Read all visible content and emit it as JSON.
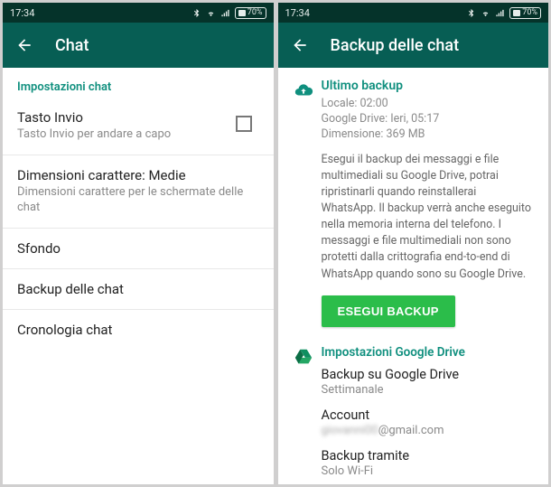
{
  "status": {
    "time": "17:34",
    "battery": "70%"
  },
  "left": {
    "title": "Chat",
    "section": "Impostazioni chat",
    "items": {
      "enter": {
        "title": "Tasto Invio",
        "sub": "Tasto Invio per andare a capo"
      },
      "font": {
        "title": "Dimensioni carattere: Medie",
        "sub": "Dimensioni carattere per le schermate delle chat"
      },
      "wallpaper": {
        "title": "Sfondo"
      },
      "backup": {
        "title": "Backup delle chat"
      },
      "history": {
        "title": "Cronologia chat"
      }
    }
  },
  "right": {
    "title": "Backup delle chat",
    "last_backup": {
      "heading": "Ultimo backup",
      "local": "Locale: 02:00",
      "gdrive": "Google Drive: Ieri, 05:17",
      "size": "Dimensione: 369 MB",
      "description": "Esegui il backup dei messaggi e file multimediali su Google Drive, potrai ripristinarli quando reinstallerai WhatsApp. Il backup verrà anche eseguito nella memoria interna del telefono. I messaggi e file multimediali non sono protetti dalla crittografia end-to-end di WhatsApp quando sono su Google Drive."
    },
    "backup_button": "ESEGUI BACKUP",
    "gdrive": {
      "heading": "Impostazioni Google Drive",
      "freq": {
        "title": "Backup su Google Drive",
        "sub": "Settimanale"
      },
      "account": {
        "title": "Account",
        "sub_hidden": "giovanni00",
        "sub_domain": "@gmail.com"
      },
      "via": {
        "title": "Backup tramite",
        "sub": "Solo Wi-Fi"
      }
    }
  }
}
